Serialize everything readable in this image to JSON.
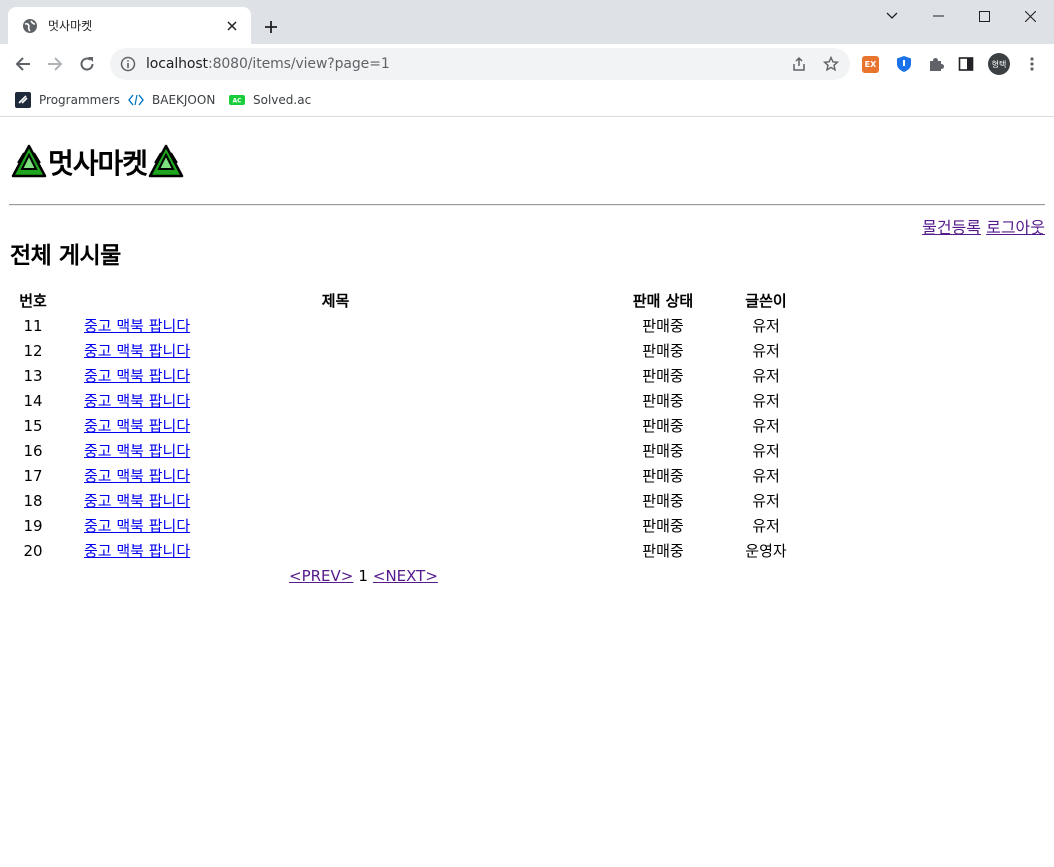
{
  "browser": {
    "tab_title": "멋사마켓",
    "url_host": "localhost",
    "url_rest": ":8080/items/view?page=1",
    "profile_initials": "형택",
    "ext_ex_label": "EX",
    "bookmarks": [
      {
        "label": "Programmers",
        "icon": "programmers-icon"
      },
      {
        "label": "BAEKJOON",
        "icon": "baekjoon-icon"
      },
      {
        "label": "Solved.ac",
        "icon": "solvedac-icon"
      }
    ],
    "solvedac_badge": "AC"
  },
  "header": {
    "site_name": "멋사마켓",
    "register_link": "물건등록",
    "logout_link": "로그아웃"
  },
  "main": {
    "section_title": "전체 게시물",
    "columns": [
      "번호",
      "제목",
      "판매 상태",
      "글쓴이"
    ],
    "rows": [
      {
        "no": "11",
        "title": "중고 맥북 팝니다",
        "status": "판매중",
        "author": "유저"
      },
      {
        "no": "12",
        "title": "중고 맥북 팝니다",
        "status": "판매중",
        "author": "유저"
      },
      {
        "no": "13",
        "title": "중고 맥북 팝니다",
        "status": "판매중",
        "author": "유저"
      },
      {
        "no": "14",
        "title": "중고 맥북 팝니다",
        "status": "판매중",
        "author": "유저"
      },
      {
        "no": "15",
        "title": "중고 맥북 팝니다",
        "status": "판매중",
        "author": "유저"
      },
      {
        "no": "16",
        "title": "중고 맥북 팝니다",
        "status": "판매중",
        "author": "유저"
      },
      {
        "no": "17",
        "title": "중고 맥북 팝니다",
        "status": "판매중",
        "author": "유저"
      },
      {
        "no": "18",
        "title": "중고 맥북 팝니다",
        "status": "판매중",
        "author": "유저"
      },
      {
        "no": "19",
        "title": "중고 맥북 팝니다",
        "status": "판매중",
        "author": "유저"
      },
      {
        "no": "20",
        "title": "중고 맥북 팝니다",
        "status": "판매중",
        "author": "운영자"
      }
    ],
    "pager": {
      "prev": "<PREV>",
      "current": "1",
      "next": "<NEXT>"
    }
  }
}
